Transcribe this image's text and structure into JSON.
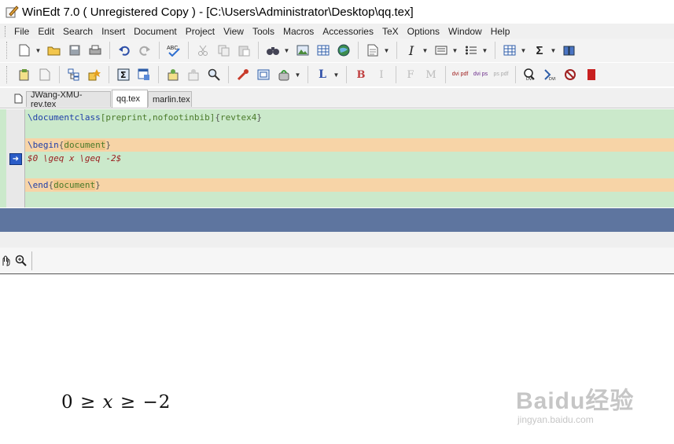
{
  "window": {
    "title": "WinEdt 7.0  ( Unregistered  Copy )  - [C:\\Users\\Administrator\\Desktop\\qq.tex]"
  },
  "menu": [
    "File",
    "Edit",
    "Search",
    "Insert",
    "Document",
    "Project",
    "View",
    "Tools",
    "Macros",
    "Accessories",
    "TeX",
    "Options",
    "Window",
    "Help"
  ],
  "toolbar": {
    "bold_label": "B",
    "italic_label": "I",
    "f_label": "F",
    "m_label": "M",
    "l_label": "L",
    "sigma_label": "Σ",
    "dvi_pdf_label": "dvi pdf",
    "dvi_ps_label": "dvi ps",
    "ps_pdf_label": "ps pdf"
  },
  "tabs": [
    "JWang-XMU-rev.tex",
    "qq.tex",
    "marlin.tex"
  ],
  "editor": {
    "line1": {
      "cmd": "\\documentclass",
      "opt": "[preprint,nofootinbib]",
      "arg_open": "{",
      "arg": "revtex4",
      "arg_close": "}"
    },
    "line2": "",
    "line3": {
      "cmd": "\\begin",
      "arg_open": "{",
      "arg": "document",
      "arg_close": "}"
    },
    "line4": "$0 \\geq x \\geq -2$",
    "line5": "",
    "line6": {
      "cmd": "\\end",
      "arg_open": "{",
      "arg": "document",
      "arg_close": "}"
    }
  },
  "preview": {
    "formula_0": "0",
    "formula_geq1": "≥",
    "formula_x": "x",
    "formula_geq2": "≥",
    "formula_rhs": "−2"
  },
  "watermark": {
    "main": "Baidu经验",
    "sub": "jingyan.baidu.com"
  },
  "colors": {
    "editor_bg": "#cbe9cb",
    "highlight_line": "#f7d4a7",
    "splitter_bar": "#5e759f"
  }
}
